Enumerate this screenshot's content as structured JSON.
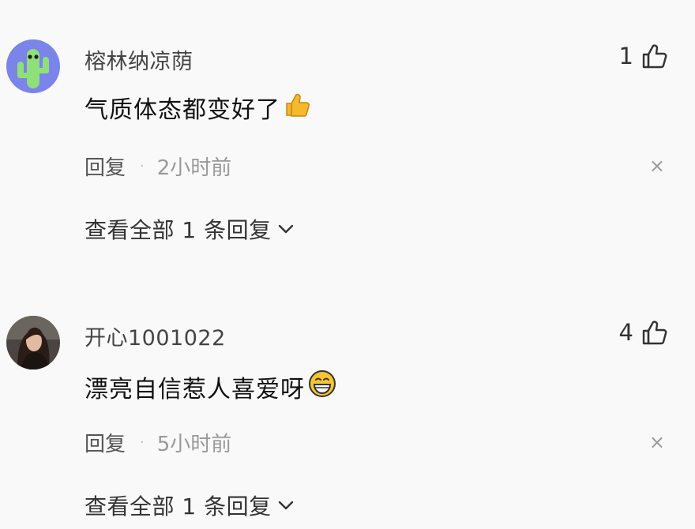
{
  "comments": [
    {
      "username": "榕林纳凉荫",
      "text": "气质体态都变好了",
      "emoji": "thumbs-up-emoji",
      "likes": "1",
      "reply_label": "回复",
      "separator": "·",
      "time": "2小时前",
      "close_glyph": "×",
      "view_replies": "查看全部 1 条回复",
      "avatar": "cactus-avatar"
    },
    {
      "username": "开心1001022",
      "text": "漂亮自信惹人喜爱呀",
      "emoji": "grinning-face-emoji",
      "likes": "4",
      "reply_label": "回复",
      "separator": "·",
      "time": "5小时前",
      "close_glyph": "×",
      "view_replies": "查看全部 1 条回复",
      "avatar": "woman-photo-avatar"
    }
  ],
  "colors": {
    "background": "#f9f9f9",
    "avatar_bg_1": "#7b84e8",
    "cactus_green": "#8fe07a",
    "emoji_yellow": "#f5b82e"
  }
}
